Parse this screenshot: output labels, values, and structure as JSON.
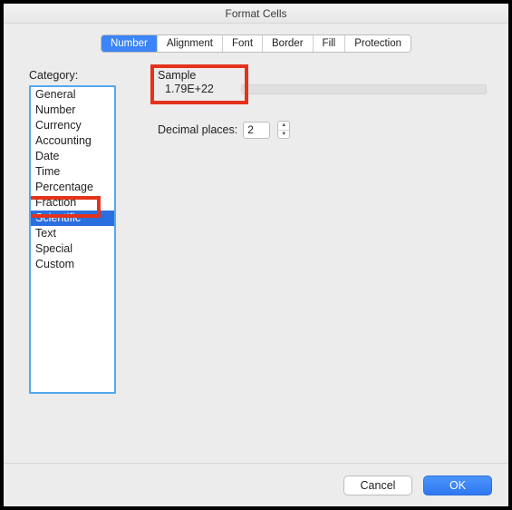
{
  "dialog": {
    "title": "Format Cells"
  },
  "tabs": {
    "items": [
      {
        "label": "Number"
      },
      {
        "label": "Alignment"
      },
      {
        "label": "Font"
      },
      {
        "label": "Border"
      },
      {
        "label": "Fill"
      },
      {
        "label": "Protection"
      }
    ],
    "selected_index": 0
  },
  "category": {
    "label": "Category:",
    "items": [
      "General",
      "Number",
      "Currency",
      "Accounting",
      "Date",
      "Time",
      "Percentage",
      "Fraction",
      "Scientific",
      "Text",
      "Special",
      "Custom"
    ],
    "selected_index": 8
  },
  "sample": {
    "label": "Sample",
    "value": "1.79E+22"
  },
  "decimal": {
    "label": "Decimal places:",
    "value": "2"
  },
  "footer": {
    "cancel": "Cancel",
    "ok": "OK"
  }
}
